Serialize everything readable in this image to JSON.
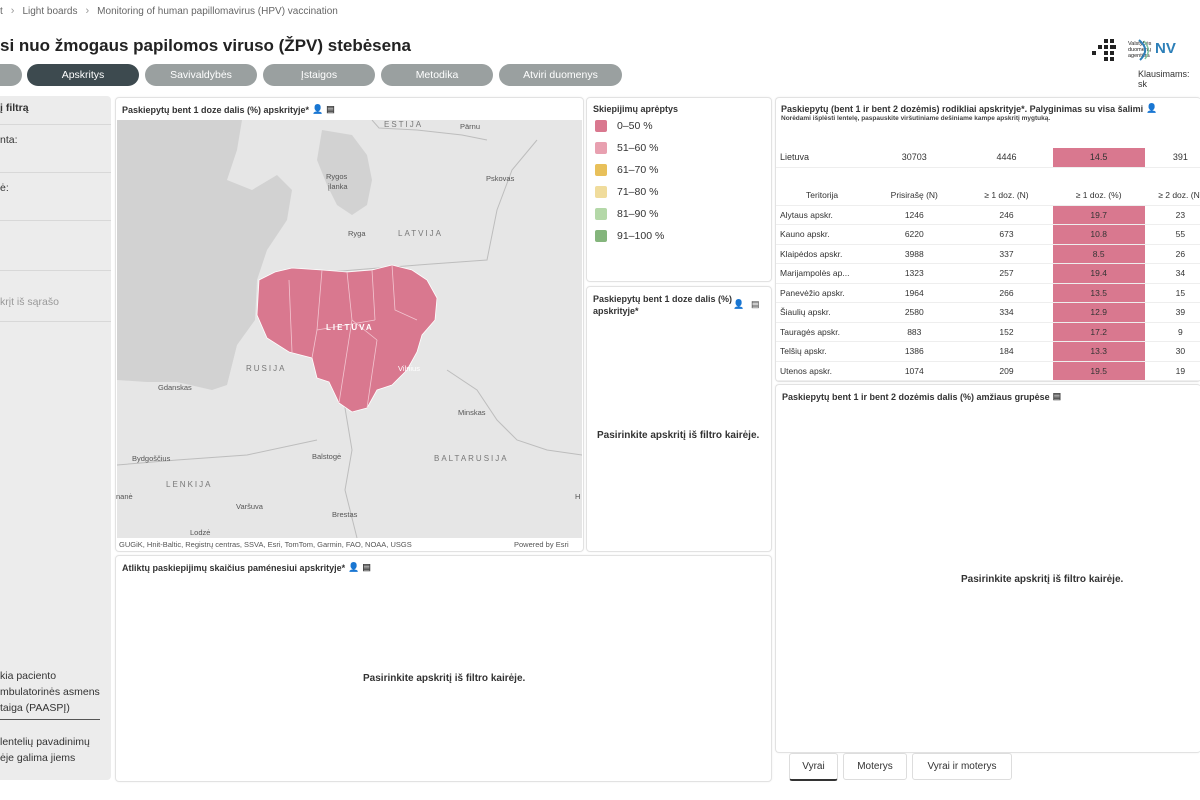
{
  "breadcrumb": [
    "t",
    "Light boards",
    "Monitoring of human papillomavirus (HPV) vaccination"
  ],
  "title": "si nuo žmogaus papilomos viruso (ŽPV) stebėsena",
  "logo": {
    "agency_line1": "Valstybės",
    "agency_line2": "duomenų",
    "agency_line3": "agentūra",
    "nvsc": "NV"
  },
  "contact": "Klausimams: sk",
  "tabs": [
    {
      "label": "",
      "active": false
    },
    {
      "label": "Apskritys",
      "active": true
    },
    {
      "label": "Savivaldybės",
      "active": false
    },
    {
      "label": "Įstaigos",
      "active": false
    },
    {
      "label": "Metodika",
      "active": false
    },
    {
      "label": "Atviri duomenys",
      "active": false
    }
  ],
  "sidebar": {
    "filter_title": "į filtrą",
    "date_label": "nta:",
    "field2_label": "ė:",
    "select_placeholder": "krįt iš sąrašo",
    "footnote1": "kia paciento\nmbulatorinės asmens\ntaiga (PAASPĮ)",
    "footnote2": "lentelių pavadinimų\nėje galima jiems"
  },
  "map_panel": {
    "title": "Paskiepytų bent 1 doze dalis (%) apskrityje*",
    "labels": {
      "estija": "ESTIJA",
      "parnu": "Pärnu",
      "rygos": "Rygos",
      "ilanka": "įlanka",
      "pskovas": "Pskovas",
      "ryga": "Ryga",
      "latvija": "LATVIJA",
      "lietuva": "LIETUVA",
      "vilnius": "Vilnius",
      "rusija": "RUSIJA",
      "gdanskas": "Gdanskas",
      "minskas": "Minskas",
      "bydgoscius": "Bydgoščius",
      "balstoge": "Balstogė",
      "baltarusija": "BALTARUSIJA",
      "lenkija": "LENKIJA",
      "nane": "nanė",
      "varsuva": "Varšuva",
      "brestas": "Brestas",
      "lodze": "Lodzė",
      "h": "H"
    },
    "attribution": "GUGiK, Hnit-Baltic, Registrų centras, SSVA, Esri, TomTom, Garmin, FAO, NOAA, USGS",
    "powered": "Powered by Esri"
  },
  "legend": {
    "title": "Skiepijimų aprėptys",
    "items": [
      {
        "label": "0–50 %",
        "color": "#d9788f"
      },
      {
        "label": "51–60 %",
        "color": "#e8a0b0"
      },
      {
        "label": "61–70 %",
        "color": "#e8c05a"
      },
      {
        "label": "71–80 %",
        "color": "#f0dc9c"
      },
      {
        "label": "81–90 %",
        "color": "#b4d8a8"
      },
      {
        "label": "91–100 %",
        "color": "#84b57c"
      }
    ]
  },
  "mid_panel": {
    "title": "Paskiepytų bent 1 doze dalis (%) apskrityje*",
    "placeholder": "Pasirinkite apskritį iš filtro kairėje."
  },
  "bottom_left_panel": {
    "title": "Atliktų paskiepijimų skaičius paménesiui apskrityje*",
    "placeholder": "Pasirinkite apskritį iš filtro kairėje."
  },
  "table_panel": {
    "title": "Paskiepytų (bent 1 ir bent 2 dozėmis) rodikliai apskrityje*. Palyginimas su visa šalimi",
    "subtitle": "Norėdami išplėsti lentelę, paspauskite viršutiniame dešiniame kampe apskritį mygtuką.",
    "national": {
      "name": "Lietuva",
      "c1": "30703",
      "c2": "4446",
      "c3": "14.5",
      "c4": "391"
    },
    "headers": [
      "Teritorija",
      "Prisirašę (N)",
      "≥ 1 doz. (N)",
      "≥ 1 doz. (%)",
      "≥ 2 doz. (N)"
    ],
    "rows": [
      {
        "name": "Alytaus apskr.",
        "c1": "1246",
        "c2": "246",
        "c3": "19.7",
        "c4": "23"
      },
      {
        "name": "Kauno apskr.",
        "c1": "6220",
        "c2": "673",
        "c3": "10.8",
        "c4": "55"
      },
      {
        "name": "Klaipėdos apskr.",
        "c1": "3988",
        "c2": "337",
        "c3": "8.5",
        "c4": "26"
      },
      {
        "name": "Marijampolės ap...",
        "c1": "1323",
        "c2": "257",
        "c3": "19.4",
        "c4": "34"
      },
      {
        "name": "Panevėžio apskr.",
        "c1": "1964",
        "c2": "266",
        "c3": "13.5",
        "c4": "15"
      },
      {
        "name": "Šiaulių apskr.",
        "c1": "2580",
        "c2": "334",
        "c3": "12.9",
        "c4": "39"
      },
      {
        "name": "Tauragės apskr.",
        "c1": "883",
        "c2": "152",
        "c3": "17.2",
        "c4": "9"
      },
      {
        "name": "Telšių apskr.",
        "c1": "1386",
        "c2": "184",
        "c3": "13.3",
        "c4": "30"
      },
      {
        "name": "Utenos apskr.",
        "c1": "1074",
        "c2": "209",
        "c3": "19.5",
        "c4": "19"
      }
    ],
    "highlight_color": "#d9788f"
  },
  "age_panel": {
    "title": "Paskiepytų bent 1 ir bent 2 dozėmis dalis (%) amžiaus grupėse",
    "placeholder": "Pasirinkite apskritį iš filtro kairėje."
  },
  "bottom_tabs": [
    {
      "label": "Vyrai",
      "active": true
    },
    {
      "label": "Moterys",
      "active": false
    },
    {
      "label": "Vyrai ir moterys",
      "active": false
    }
  ]
}
